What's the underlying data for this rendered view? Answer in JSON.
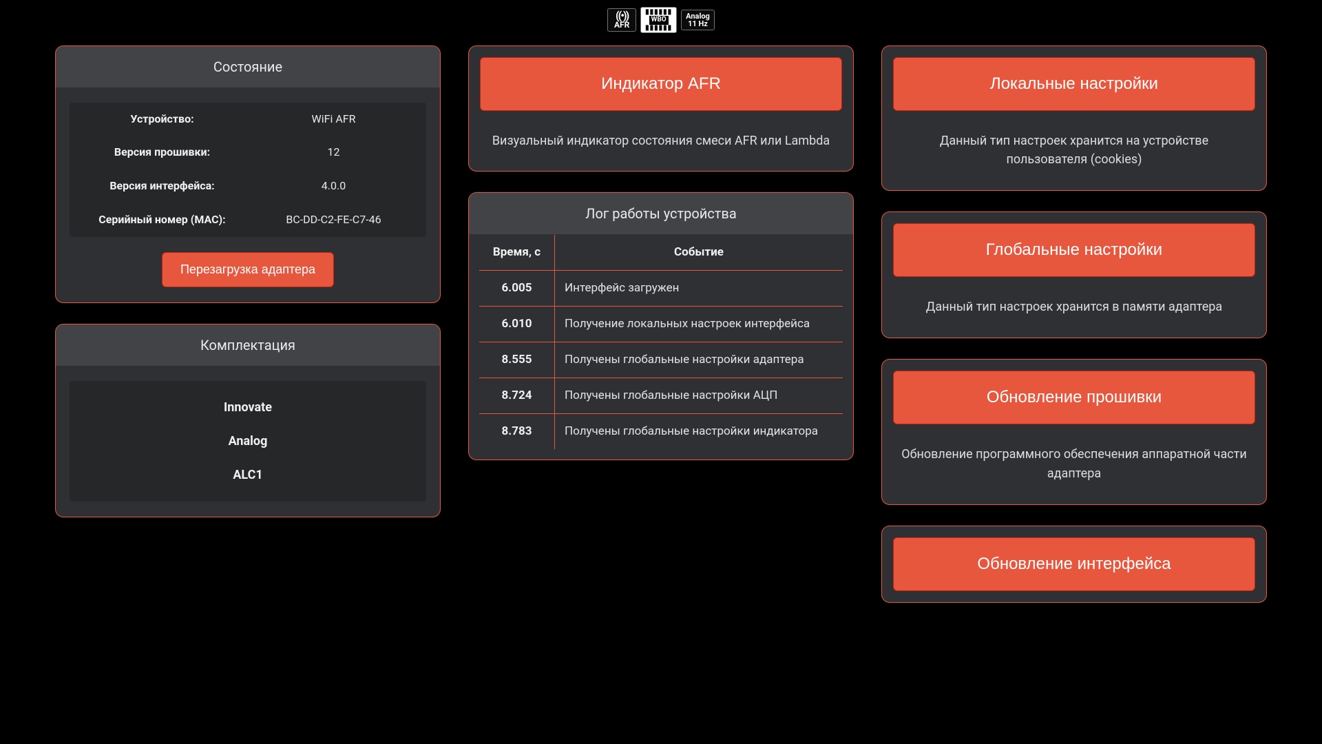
{
  "topbar": {
    "afr_icon_label": "AFR",
    "wbo_label": "WBO",
    "analog_top": "Analog",
    "analog_bottom": "11 Hz"
  },
  "status": {
    "title": "Состояние",
    "rows": [
      {
        "key": "Устройство:",
        "val": "WiFi AFR"
      },
      {
        "key": "Версия прошивки:",
        "val": "12"
      },
      {
        "key": "Версия интерфейса:",
        "val": "4.0.0"
      },
      {
        "key": "Серийный номер (MAC):",
        "val": "BC-DD-C2-FE-C7-46"
      }
    ],
    "restart_label": "Перезагрузка адаптера"
  },
  "equipment": {
    "title": "Комплектация",
    "items": [
      "Innovate",
      "Analog",
      "ALC1"
    ]
  },
  "afr_card": {
    "button": "Индикатор AFR",
    "desc": "Визуальный индикатор состояния смеси AFR или Lambda"
  },
  "log": {
    "title": "Лог работы устройства",
    "col_time": "Время, с",
    "col_event": "Событие",
    "rows": [
      {
        "t": "6.005",
        "e": "Интерфейс загружен"
      },
      {
        "t": "6.010",
        "e": "Получение локальных настроек интерфейса"
      },
      {
        "t": "8.555",
        "e": "Получены глобальные настройки адаптера"
      },
      {
        "t": "8.724",
        "e": "Получены глобальные настройки АЦП"
      },
      {
        "t": "8.783",
        "e": "Получены глобальные настройки индикатора"
      }
    ]
  },
  "cards_right": [
    {
      "button": "Локальные настройки",
      "desc": "Данный тип настроек хранится на устройстве пользователя (cookies)"
    },
    {
      "button": "Глобальные настройки",
      "desc": "Данный тип настроек хранится в памяти адаптера"
    },
    {
      "button": "Обновление прошивки",
      "desc": "Обновление программного обеспечения аппаратной части адаптера"
    },
    {
      "button": "Обновление интерфейса",
      "desc": ""
    }
  ]
}
